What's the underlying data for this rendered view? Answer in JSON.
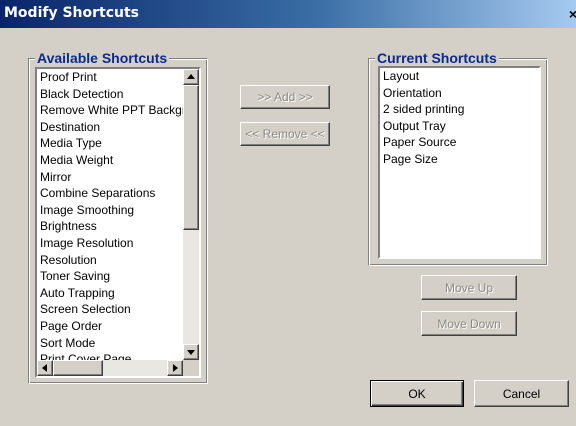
{
  "window": {
    "title": "Modify Shortcuts",
    "close_glyph": "×"
  },
  "available": {
    "legend": "Available Shortcuts",
    "items": [
      "Proof Print",
      "Black Detection",
      "Remove White PPT Background",
      "Destination",
      "Media Type",
      "Media Weight",
      "Mirror",
      "Combine Separations",
      "Image Smoothing",
      "Brightness",
      "Image Resolution",
      "Resolution",
      "Toner Saving",
      "Auto Trapping",
      "Screen Selection",
      "Page Order",
      "Sort Mode",
      "Print Cover Page"
    ]
  },
  "current": {
    "legend": "Current Shortcuts",
    "items": [
      "Layout",
      "Orientation",
      "2 sided printing",
      "Output Tray",
      "Paper Source",
      "Page Size"
    ]
  },
  "buttons": {
    "add": ">> Add >>",
    "remove": "<< Remove <<",
    "move_up": "Move Up",
    "move_down": "Move Down",
    "ok": "OK",
    "cancel": "Cancel"
  },
  "icons": {
    "close": "close-icon",
    "scroll_up": "arrow-up-icon",
    "scroll_down": "arrow-down-icon",
    "scroll_left": "arrow-left-icon",
    "scroll_right": "arrow-right-icon"
  },
  "colors": {
    "title_start": "#0a246a",
    "title_end": "#a6caf0",
    "legend_text": "#0b2b8c",
    "face": "#d4d0c8"
  }
}
